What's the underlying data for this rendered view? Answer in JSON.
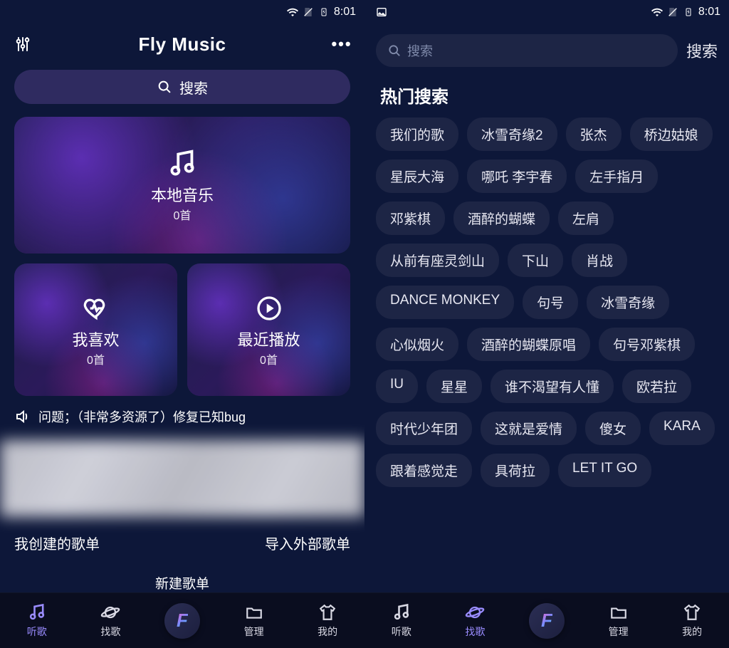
{
  "statusbar": {
    "time": "8:01"
  },
  "header": {
    "title": "Fly Music"
  },
  "search_pill": {
    "label": "搜索"
  },
  "cards": {
    "local": {
      "title": "本地音乐",
      "sub": "0首"
    },
    "fav": {
      "title": "我喜欢",
      "sub": "0首"
    },
    "recent": {
      "title": "最近播放",
      "sub": "0首"
    }
  },
  "notice": {
    "text": "问题；（非常多资源了）修复已知bug"
  },
  "playlist_head": {
    "mine": "我创建的歌单",
    "import": "导入外部歌单",
    "new": "新建歌单"
  },
  "bottom_nav": {
    "items": [
      {
        "label": "听歌"
      },
      {
        "label": "找歌"
      },
      {
        "label": "管理"
      },
      {
        "label": "我的"
      }
    ]
  },
  "search2": {
    "placeholder": "搜索",
    "button": "搜索",
    "hot_title": "热门搜索",
    "tags": [
      "我们的歌",
      "冰雪奇缘2",
      "张杰",
      "桥边姑娘",
      "星辰大海",
      "哪吒 李宇春",
      "左手指月",
      "邓紫棋",
      "酒醉的蝴蝶",
      "左肩",
      "从前有座灵剑山",
      "下山",
      "肖战",
      "DANCE MONKEY",
      "句号",
      "冰雪奇缘",
      "心似烟火",
      "酒醉的蝴蝶原唱",
      "句号邓紫棋",
      "IU",
      "星星",
      "谁不渴望有人懂",
      "欧若拉",
      "时代少年团",
      "这就是爱情",
      "傻女",
      "KARA",
      "跟着感觉走",
      "具荷拉",
      "LET IT GO"
    ]
  }
}
